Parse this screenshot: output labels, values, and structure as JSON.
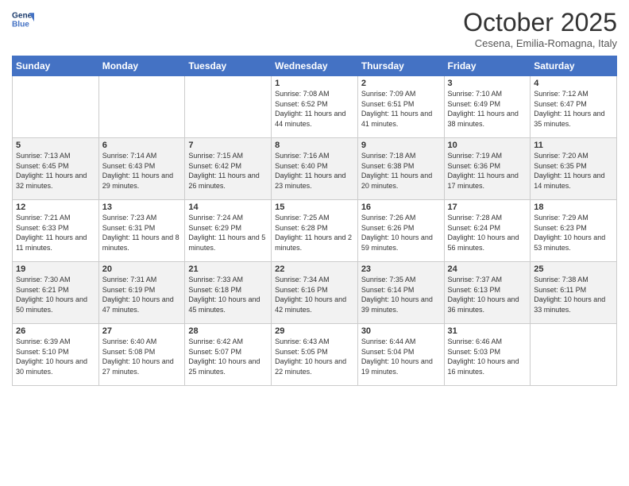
{
  "header": {
    "logo_line1": "General",
    "logo_line2": "Blue",
    "month": "October 2025",
    "location": "Cesena, Emilia-Romagna, Italy"
  },
  "weekdays": [
    "Sunday",
    "Monday",
    "Tuesday",
    "Wednesday",
    "Thursday",
    "Friday",
    "Saturday"
  ],
  "weeks": [
    [
      {
        "day": "",
        "sunrise": "",
        "sunset": "",
        "daylight": ""
      },
      {
        "day": "",
        "sunrise": "",
        "sunset": "",
        "daylight": ""
      },
      {
        "day": "",
        "sunrise": "",
        "sunset": "",
        "daylight": ""
      },
      {
        "day": "1",
        "sunrise": "Sunrise: 7:08 AM",
        "sunset": "Sunset: 6:52 PM",
        "daylight": "Daylight: 11 hours and 44 minutes."
      },
      {
        "day": "2",
        "sunrise": "Sunrise: 7:09 AM",
        "sunset": "Sunset: 6:51 PM",
        "daylight": "Daylight: 11 hours and 41 minutes."
      },
      {
        "day": "3",
        "sunrise": "Sunrise: 7:10 AM",
        "sunset": "Sunset: 6:49 PM",
        "daylight": "Daylight: 11 hours and 38 minutes."
      },
      {
        "day": "4",
        "sunrise": "Sunrise: 7:12 AM",
        "sunset": "Sunset: 6:47 PM",
        "daylight": "Daylight: 11 hours and 35 minutes."
      }
    ],
    [
      {
        "day": "5",
        "sunrise": "Sunrise: 7:13 AM",
        "sunset": "Sunset: 6:45 PM",
        "daylight": "Daylight: 11 hours and 32 minutes."
      },
      {
        "day": "6",
        "sunrise": "Sunrise: 7:14 AM",
        "sunset": "Sunset: 6:43 PM",
        "daylight": "Daylight: 11 hours and 29 minutes."
      },
      {
        "day": "7",
        "sunrise": "Sunrise: 7:15 AM",
        "sunset": "Sunset: 6:42 PM",
        "daylight": "Daylight: 11 hours and 26 minutes."
      },
      {
        "day": "8",
        "sunrise": "Sunrise: 7:16 AM",
        "sunset": "Sunset: 6:40 PM",
        "daylight": "Daylight: 11 hours and 23 minutes."
      },
      {
        "day": "9",
        "sunrise": "Sunrise: 7:18 AM",
        "sunset": "Sunset: 6:38 PM",
        "daylight": "Daylight: 11 hours and 20 minutes."
      },
      {
        "day": "10",
        "sunrise": "Sunrise: 7:19 AM",
        "sunset": "Sunset: 6:36 PM",
        "daylight": "Daylight: 11 hours and 17 minutes."
      },
      {
        "day": "11",
        "sunrise": "Sunrise: 7:20 AM",
        "sunset": "Sunset: 6:35 PM",
        "daylight": "Daylight: 11 hours and 14 minutes."
      }
    ],
    [
      {
        "day": "12",
        "sunrise": "Sunrise: 7:21 AM",
        "sunset": "Sunset: 6:33 PM",
        "daylight": "Daylight: 11 hours and 11 minutes."
      },
      {
        "day": "13",
        "sunrise": "Sunrise: 7:23 AM",
        "sunset": "Sunset: 6:31 PM",
        "daylight": "Daylight: 11 hours and 8 minutes."
      },
      {
        "day": "14",
        "sunrise": "Sunrise: 7:24 AM",
        "sunset": "Sunset: 6:29 PM",
        "daylight": "Daylight: 11 hours and 5 minutes."
      },
      {
        "day": "15",
        "sunrise": "Sunrise: 7:25 AM",
        "sunset": "Sunset: 6:28 PM",
        "daylight": "Daylight: 11 hours and 2 minutes."
      },
      {
        "day": "16",
        "sunrise": "Sunrise: 7:26 AM",
        "sunset": "Sunset: 6:26 PM",
        "daylight": "Daylight: 10 hours and 59 minutes."
      },
      {
        "day": "17",
        "sunrise": "Sunrise: 7:28 AM",
        "sunset": "Sunset: 6:24 PM",
        "daylight": "Daylight: 10 hours and 56 minutes."
      },
      {
        "day": "18",
        "sunrise": "Sunrise: 7:29 AM",
        "sunset": "Sunset: 6:23 PM",
        "daylight": "Daylight: 10 hours and 53 minutes."
      }
    ],
    [
      {
        "day": "19",
        "sunrise": "Sunrise: 7:30 AM",
        "sunset": "Sunset: 6:21 PM",
        "daylight": "Daylight: 10 hours and 50 minutes."
      },
      {
        "day": "20",
        "sunrise": "Sunrise: 7:31 AM",
        "sunset": "Sunset: 6:19 PM",
        "daylight": "Daylight: 10 hours and 47 minutes."
      },
      {
        "day": "21",
        "sunrise": "Sunrise: 7:33 AM",
        "sunset": "Sunset: 6:18 PM",
        "daylight": "Daylight: 10 hours and 45 minutes."
      },
      {
        "day": "22",
        "sunrise": "Sunrise: 7:34 AM",
        "sunset": "Sunset: 6:16 PM",
        "daylight": "Daylight: 10 hours and 42 minutes."
      },
      {
        "day": "23",
        "sunrise": "Sunrise: 7:35 AM",
        "sunset": "Sunset: 6:14 PM",
        "daylight": "Daylight: 10 hours and 39 minutes."
      },
      {
        "day": "24",
        "sunrise": "Sunrise: 7:37 AM",
        "sunset": "Sunset: 6:13 PM",
        "daylight": "Daylight: 10 hours and 36 minutes."
      },
      {
        "day": "25",
        "sunrise": "Sunrise: 7:38 AM",
        "sunset": "Sunset: 6:11 PM",
        "daylight": "Daylight: 10 hours and 33 minutes."
      }
    ],
    [
      {
        "day": "26",
        "sunrise": "Sunrise: 6:39 AM",
        "sunset": "Sunset: 5:10 PM",
        "daylight": "Daylight: 10 hours and 30 minutes."
      },
      {
        "day": "27",
        "sunrise": "Sunrise: 6:40 AM",
        "sunset": "Sunset: 5:08 PM",
        "daylight": "Daylight: 10 hours and 27 minutes."
      },
      {
        "day": "28",
        "sunrise": "Sunrise: 6:42 AM",
        "sunset": "Sunset: 5:07 PM",
        "daylight": "Daylight: 10 hours and 25 minutes."
      },
      {
        "day": "29",
        "sunrise": "Sunrise: 6:43 AM",
        "sunset": "Sunset: 5:05 PM",
        "daylight": "Daylight: 10 hours and 22 minutes."
      },
      {
        "day": "30",
        "sunrise": "Sunrise: 6:44 AM",
        "sunset": "Sunset: 5:04 PM",
        "daylight": "Daylight: 10 hours and 19 minutes."
      },
      {
        "day": "31",
        "sunrise": "Sunrise: 6:46 AM",
        "sunset": "Sunset: 5:03 PM",
        "daylight": "Daylight: 10 hours and 16 minutes."
      },
      {
        "day": "",
        "sunrise": "",
        "sunset": "",
        "daylight": ""
      }
    ]
  ]
}
